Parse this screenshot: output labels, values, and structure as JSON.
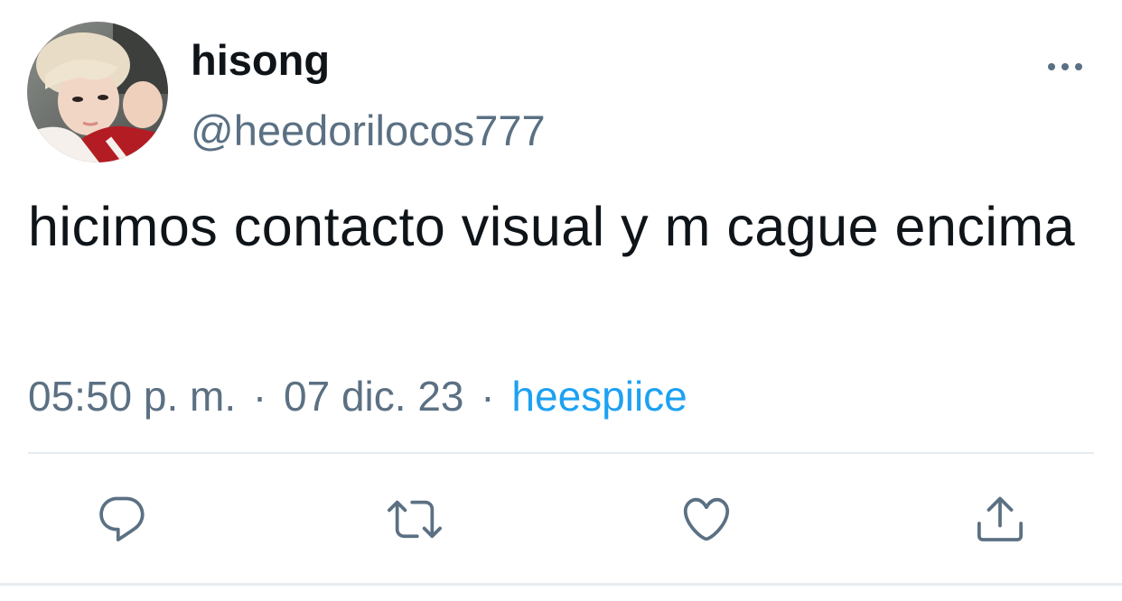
{
  "tweet": {
    "display_name": "hisong",
    "handle": "@heedorilocos777",
    "text": "hicimos contacto visual y m cague encima",
    "time": "05:50 p. m.",
    "separator": "·",
    "date": "07 dic. 23",
    "source": "heespiice"
  },
  "actions": {
    "icons": [
      "reply-icon",
      "retweet-icon",
      "like-icon",
      "share-icon"
    ]
  },
  "colors": {
    "text": "#0f1419",
    "secondary": "#5b7083",
    "link": "#1da1f2",
    "divider": "#e6ecf0"
  }
}
